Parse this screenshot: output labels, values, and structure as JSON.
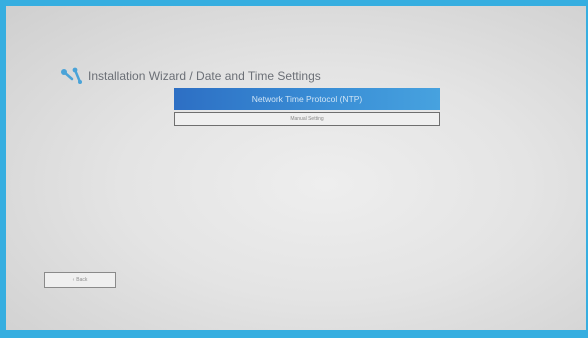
{
  "header": {
    "title": "Installation Wizard / Date and Time Settings",
    "icon": "installation-wizard-icon"
  },
  "options": {
    "ntp_label": "Network Time Protocol (NTP)",
    "manual_label": "Manual Setting"
  },
  "footer": {
    "back_label": "Back",
    "back_icon": "chevron-left-icon"
  },
  "colors": {
    "frame_border": "#36aee0",
    "selected_option": "#3a8fd6",
    "background": "#e4e4e4"
  }
}
